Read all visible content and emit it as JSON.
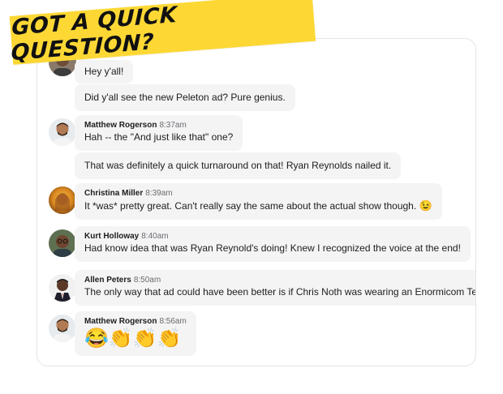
{
  "banner": {
    "text": "Got a quick question?"
  },
  "messages": [
    {
      "sender": "",
      "time": "",
      "text": "Hey y'all!"
    },
    {
      "sender": "",
      "time": "",
      "text": "Did y'all see the new Peleton ad? Pure genius."
    },
    {
      "sender": "Matthew Rogerson",
      "time": "8:37am",
      "text": "Hah -- the \"And just like that\" one?"
    },
    {
      "sender": "",
      "time": "",
      "text": "That was definitely a quick turnaround on that! Ryan Reynolds nailed it."
    },
    {
      "sender": "Christina Miller",
      "time": "8:39am",
      "text": "It *was* pretty great. Can't really say the same about the actual show though.",
      "emoji": "😉"
    },
    {
      "sender": "Kurt Holloway",
      "time": "8:40am",
      "text": "Had know idea that was Ryan Reynold's doing! Knew I recognized the voice at the end!"
    },
    {
      "sender": "Allen Peters",
      "time": "8:50am",
      "text": "The only way that ad could have been better is if Chris Noth was wearing an Enormicom Te"
    },
    {
      "sender": "Matthew Rogerson",
      "time": "8:56am",
      "text": "😂👏👏👏"
    }
  ],
  "colors": {
    "banner": "#fdd835",
    "bubble": "#f4f4f5",
    "border": "#e4e4e7"
  },
  "icons": [
    "avatar-photo",
    "avatar-matthew",
    "avatar-christina",
    "avatar-kurt",
    "avatar-allen"
  ]
}
